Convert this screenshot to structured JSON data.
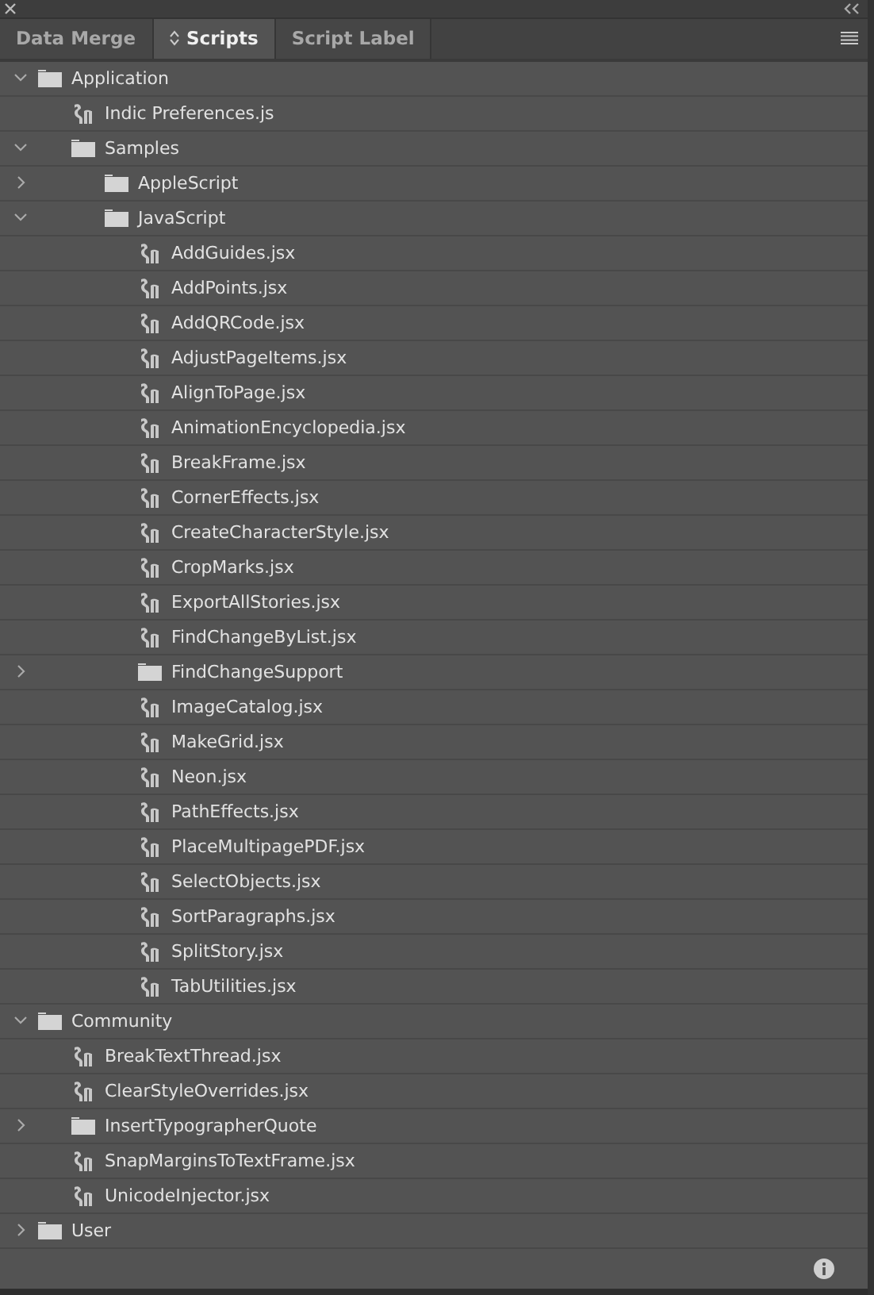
{
  "tabs": [
    {
      "label": "Data Merge",
      "selected": false
    },
    {
      "label": "Scripts",
      "selected": true
    },
    {
      "label": "Script Label",
      "selected": false
    }
  ],
  "tree": [
    {
      "label": "Application",
      "kind": "folder",
      "expanded": true,
      "children": [
        {
          "label": "Indic Preferences.js",
          "kind": "script"
        },
        {
          "label": "Samples",
          "kind": "folder",
          "expanded": true,
          "children": [
            {
              "label": "AppleScript",
              "kind": "folder",
              "expanded": false
            },
            {
              "label": "JavaScript",
              "kind": "folder",
              "expanded": true,
              "children": [
                {
                  "label": "AddGuides.jsx",
                  "kind": "script"
                },
                {
                  "label": "AddPoints.jsx",
                  "kind": "script"
                },
                {
                  "label": "AddQRCode.jsx",
                  "kind": "script"
                },
                {
                  "label": "AdjustPageItems.jsx",
                  "kind": "script"
                },
                {
                  "label": "AlignToPage.jsx",
                  "kind": "script"
                },
                {
                  "label": "AnimationEncyclopedia.jsx",
                  "kind": "script"
                },
                {
                  "label": "BreakFrame.jsx",
                  "kind": "script"
                },
                {
                  "label": "CornerEffects.jsx",
                  "kind": "script"
                },
                {
                  "label": "CreateCharacterStyle.jsx",
                  "kind": "script"
                },
                {
                  "label": "CropMarks.jsx",
                  "kind": "script"
                },
                {
                  "label": "ExportAllStories.jsx",
                  "kind": "script"
                },
                {
                  "label": "FindChangeByList.jsx",
                  "kind": "script"
                },
                {
                  "label": "FindChangeSupport",
                  "kind": "folder",
                  "expanded": false
                },
                {
                  "label": "ImageCatalog.jsx",
                  "kind": "script"
                },
                {
                  "label": "MakeGrid.jsx",
                  "kind": "script"
                },
                {
                  "label": "Neon.jsx",
                  "kind": "script"
                },
                {
                  "label": "PathEffects.jsx",
                  "kind": "script"
                },
                {
                  "label": "PlaceMultipagePDF.jsx",
                  "kind": "script"
                },
                {
                  "label": "SelectObjects.jsx",
                  "kind": "script"
                },
                {
                  "label": "SortParagraphs.jsx",
                  "kind": "script"
                },
                {
                  "label": "SplitStory.jsx",
                  "kind": "script"
                },
                {
                  "label": "TabUtilities.jsx",
                  "kind": "script"
                }
              ]
            }
          ]
        }
      ]
    },
    {
      "label": "Community",
      "kind": "folder",
      "expanded": true,
      "children": [
        {
          "label": "BreakTextThread.jsx",
          "kind": "script"
        },
        {
          "label": "ClearStyleOverrides.jsx",
          "kind": "script"
        },
        {
          "label": "InsertTypographerQuote",
          "kind": "folder",
          "expanded": false
        },
        {
          "label": "SnapMarginsToTextFrame.jsx",
          "kind": "script"
        },
        {
          "label": "UnicodeInjector.jsx",
          "kind": "script"
        }
      ]
    },
    {
      "label": "User",
      "kind": "folder",
      "expanded": false
    }
  ]
}
